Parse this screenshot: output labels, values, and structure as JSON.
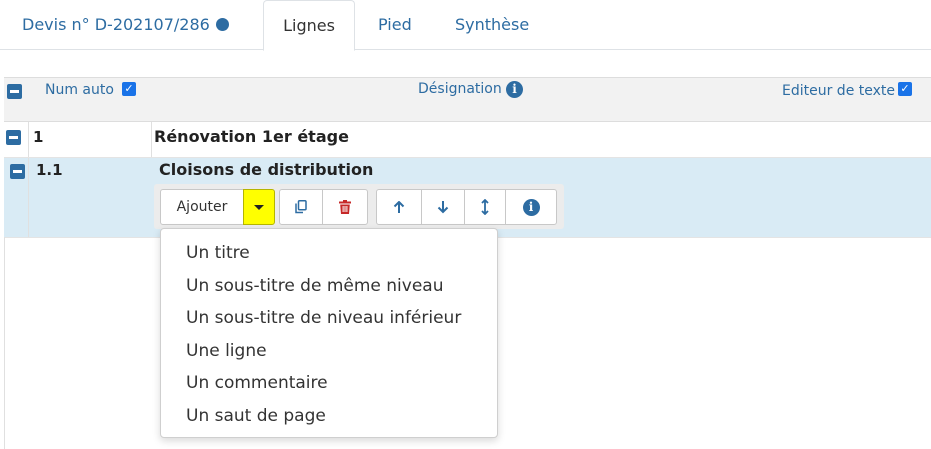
{
  "tabs": {
    "devis": "Devis n° D-202107/286",
    "lignes": "Lignes",
    "pied": "Pied",
    "synthese": "Synthèse"
  },
  "table_header": {
    "num_auto": "Num auto",
    "num_auto_checked": true,
    "designation": "Désignation",
    "editeur": "Editeur de texte",
    "editeur_checked": true
  },
  "rows": [
    {
      "num": "1",
      "title": "Rénovation 1er étage"
    },
    {
      "num": "1.1",
      "title": "Cloisons de distribution"
    }
  ],
  "toolbar": {
    "ajouter": "Ajouter",
    "icons": [
      "caret-down-icon",
      "copy-icon",
      "trash-icon",
      "arrow-up-icon",
      "arrow-down-icon",
      "arrows-updown-icon",
      "info-icon"
    ]
  },
  "dropdown": {
    "items": [
      "Un titre",
      "Un sous-titre de même niveau",
      "Un sous-titre de niveau inférieur",
      "Une ligne",
      "Un commentaire",
      "Un saut de page"
    ]
  },
  "colors": {
    "accent": "#2d6ca2",
    "highlight_row": "#d9ebf5",
    "caret_button": "#ffff00",
    "trash": "#c62828"
  }
}
